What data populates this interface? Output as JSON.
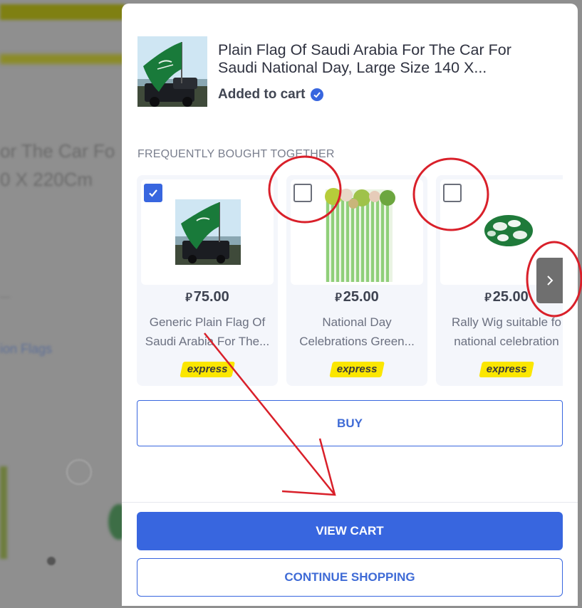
{
  "background_page": {
    "title_line_1": "or The Car Fo",
    "title_line_2": "0 X 220Cm",
    "link_text": "ion Flags"
  },
  "cart_drawer": {
    "product_title": "Plain Flag Of Saudi Arabia For The Car For Saudi National Day, Large Size 140 X...",
    "added_status": "Added to cart",
    "fbt_heading": "FREQUENTLY BOUGHT TOGETHER",
    "currency_symbol": "⃁",
    "items": [
      {
        "checked": true,
        "price": "75.00",
        "name_line_1": "Generic Plain Flag Of",
        "name_line_2": "Saudi Arabia For The...",
        "badge": "express"
      },
      {
        "checked": false,
        "price": "25.00",
        "name_line_1": "National Day",
        "name_line_2": "Celebrations Green...",
        "badge": "express"
      },
      {
        "checked": false,
        "price": "25.00",
        "name_line_1": "Rally Wig suitable fo",
        "name_line_2": "national celebration",
        "badge": "express"
      }
    ],
    "buy_label": "BUY",
    "view_cart_label": "VIEW CART",
    "continue_label": "CONTINUE SHOPPING"
  },
  "colors": {
    "accent": "#3866df",
    "express_badge": "#fbe600",
    "annotation": "#d9202a"
  }
}
